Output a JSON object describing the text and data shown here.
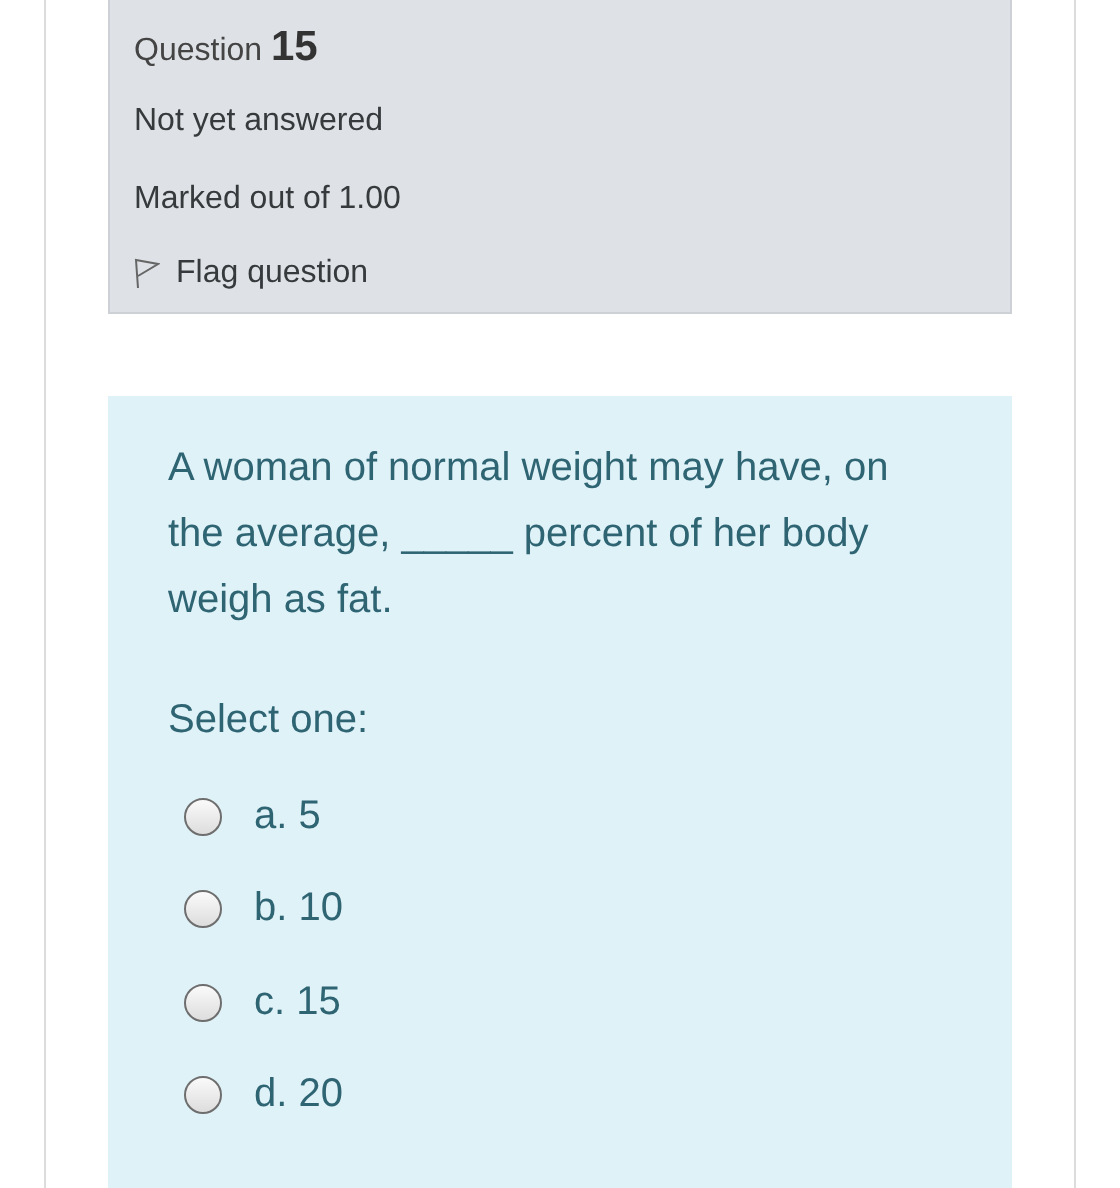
{
  "info": {
    "question_label": "Question",
    "question_number": "15",
    "status": "Not yet answered",
    "marks": "Marked out of 1.00",
    "flag": {
      "label": "Flag question",
      "flagged": false
    }
  },
  "question": {
    "text": "A woman of normal weight may have, on the average, _____ percent of her body weigh as fat.",
    "prompt": "Select one:",
    "options": [
      {
        "label": "a. 5",
        "selected": false
      },
      {
        "label": "b. 10",
        "selected": false
      },
      {
        "label": "c. 15",
        "selected": false
      },
      {
        "label": "d. 20",
        "selected": false
      }
    ]
  }
}
